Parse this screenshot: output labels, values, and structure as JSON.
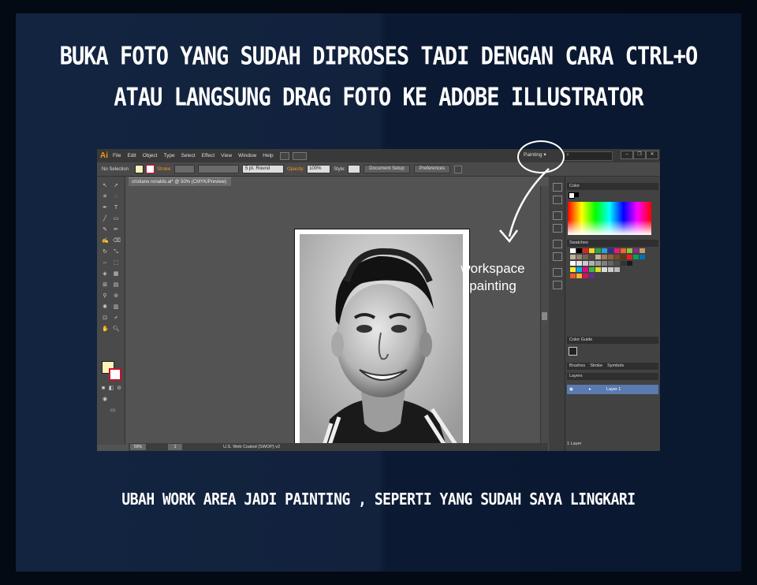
{
  "headline": {
    "line1": "BUKA FOTO YANG SUDAH DIPROSES TADI DENGAN CARA CTRL+O",
    "line2": "ATAU LANGSUNG DRAG FOTO KE ADOBE ILLUSTRATOR"
  },
  "caption": "UBAH WORK AREA JADI PAINTING , SEPERTI YANG SUDAH SAYA LINGKARI",
  "annotation": {
    "line1": "workspace",
    "line2": "painting"
  },
  "app": {
    "logo": "Ai",
    "menu": [
      "File",
      "Edit",
      "Object",
      "Type",
      "Select",
      "Effect",
      "View",
      "Window",
      "Help"
    ],
    "workspace": "Painting",
    "workspace_arrow": "▾",
    "window_buttons": [
      "‒",
      "❐",
      "✕"
    ]
  },
  "control_bar": {
    "selection": "No Selection",
    "stroke_label": "Stroke:",
    "brush": "5 pt. Round",
    "opacity_label": "Opacity:",
    "opacity_value": "100%",
    "style_label": "Style:",
    "document_setup": "Document Setup",
    "preferences": "Preferences"
  },
  "document": {
    "tab_title": "cristiano ronaldo.ai* @ 50% (CMYK/Preview)",
    "zoom": "50%",
    "page": "1",
    "profile": "U.S. Web Coated (SWOP) v2"
  },
  "panels": {
    "color": "Color",
    "swatches": "Swatches",
    "color_guide": "Color Guide",
    "brushes": "Brushes",
    "stroke": "Stroke",
    "symbols": "Symbols",
    "layers": "Layers",
    "layer_name": "Layer 1",
    "layer_count": "1 Layer"
  },
  "colors": {
    "accent": "#f7941d",
    "layer_highlight": "#5a7ab0"
  }
}
